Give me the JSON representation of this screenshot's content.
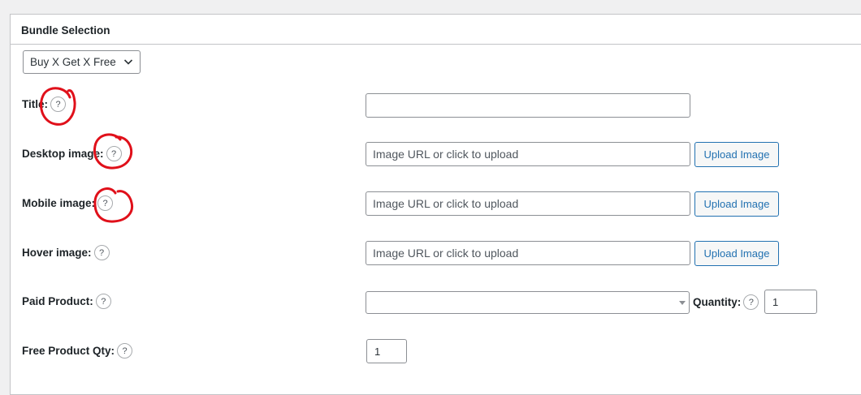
{
  "panel": {
    "title": "Bundle Selection"
  },
  "bundle_select": {
    "value": "Buy X Get X Free"
  },
  "fields": {
    "title": {
      "label": "Title:",
      "value": ""
    },
    "desktop_image": {
      "label": "Desktop image:",
      "placeholder": "Image URL or click to upload",
      "button": "Upload Image"
    },
    "mobile_image": {
      "label": "Mobile image:",
      "placeholder": "Image URL or click to upload",
      "button": "Upload Image"
    },
    "hover_image": {
      "label": "Hover image:",
      "placeholder": "Image URL or click to upload",
      "button": "Upload Image"
    },
    "paid_product": {
      "label": "Paid Product:",
      "value": ""
    },
    "quantity": {
      "label": "Quantity:",
      "value": "1"
    },
    "free_product_qty": {
      "label": "Free Product Qty:",
      "value": "1"
    }
  },
  "help_glyph": "?",
  "colors": {
    "annotation": "#e0101a",
    "accent": "#2271b1"
  }
}
